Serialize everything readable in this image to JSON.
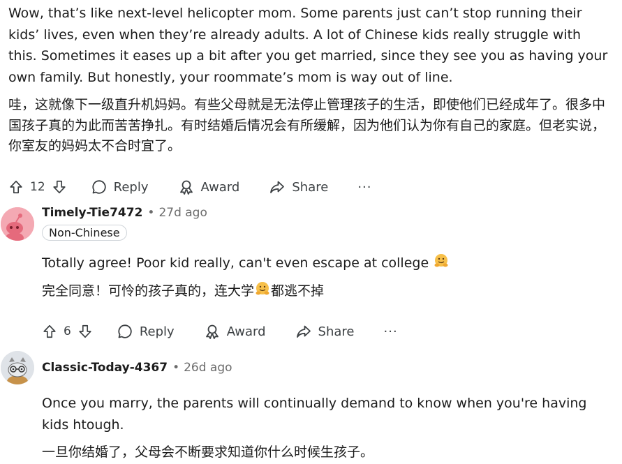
{
  "top_comment": {
    "text_en": "Wow, that’s like next-level helicopter mom. Some parents just can’t stop running their kids’ lives, even when they’re already adults. A lot of Chinese kids really struggle with this. Sometimes it eases up a bit after you get married, since they see you as having your own family. But honestly, your roommate’s mom is way out of line.",
    "text_zh": "哇，这就像下一级直升机妈妈。有些父母就是无法停止管理孩子的生活，即使他们已经成年了。很多中国孩子真的为此而苦苦挣扎。有时结婚后情况会有所缓解，因为他们认为你有自己的家庭。但老实说，你室友的妈妈太不合时宜了。",
    "vote_count": "12",
    "reply_label": "Reply",
    "award_label": "Award",
    "share_label": "Share",
    "more_label": "···"
  },
  "reply1": {
    "username": "Timely-Tie7472",
    "separator": "•",
    "time": "27d ago",
    "flair": "Non-Chinese",
    "text_en": "Totally agree! Poor kid really, can't even escape at college",
    "text_zh_before": "完全同意！可怜的孩子真的，连大学",
    "text_zh_after": "都逃不掉",
    "vote_count": "6",
    "reply_label": "Reply",
    "award_label": "Award",
    "share_label": "Share",
    "more_label": "···"
  },
  "reply2": {
    "username": "Classic-Today-4367",
    "separator": "•",
    "time": "26d ago",
    "text_en": "Once you marry, the parents will continually demand to know when you're having kids htough.",
    "text_zh": "一旦你结婚了，父母会不断要求知道你什么时候生孩子。"
  },
  "colors": {
    "text": "#1c1c1c",
    "muted": "#6b6b6b",
    "avatar1_bg": "#f4a9b3",
    "flair_border": "#cfd4d9"
  },
  "icons": [
    "upvote-icon",
    "downvote-icon",
    "comment-icon",
    "award-icon",
    "share-icon",
    "hugging-emoji"
  ]
}
